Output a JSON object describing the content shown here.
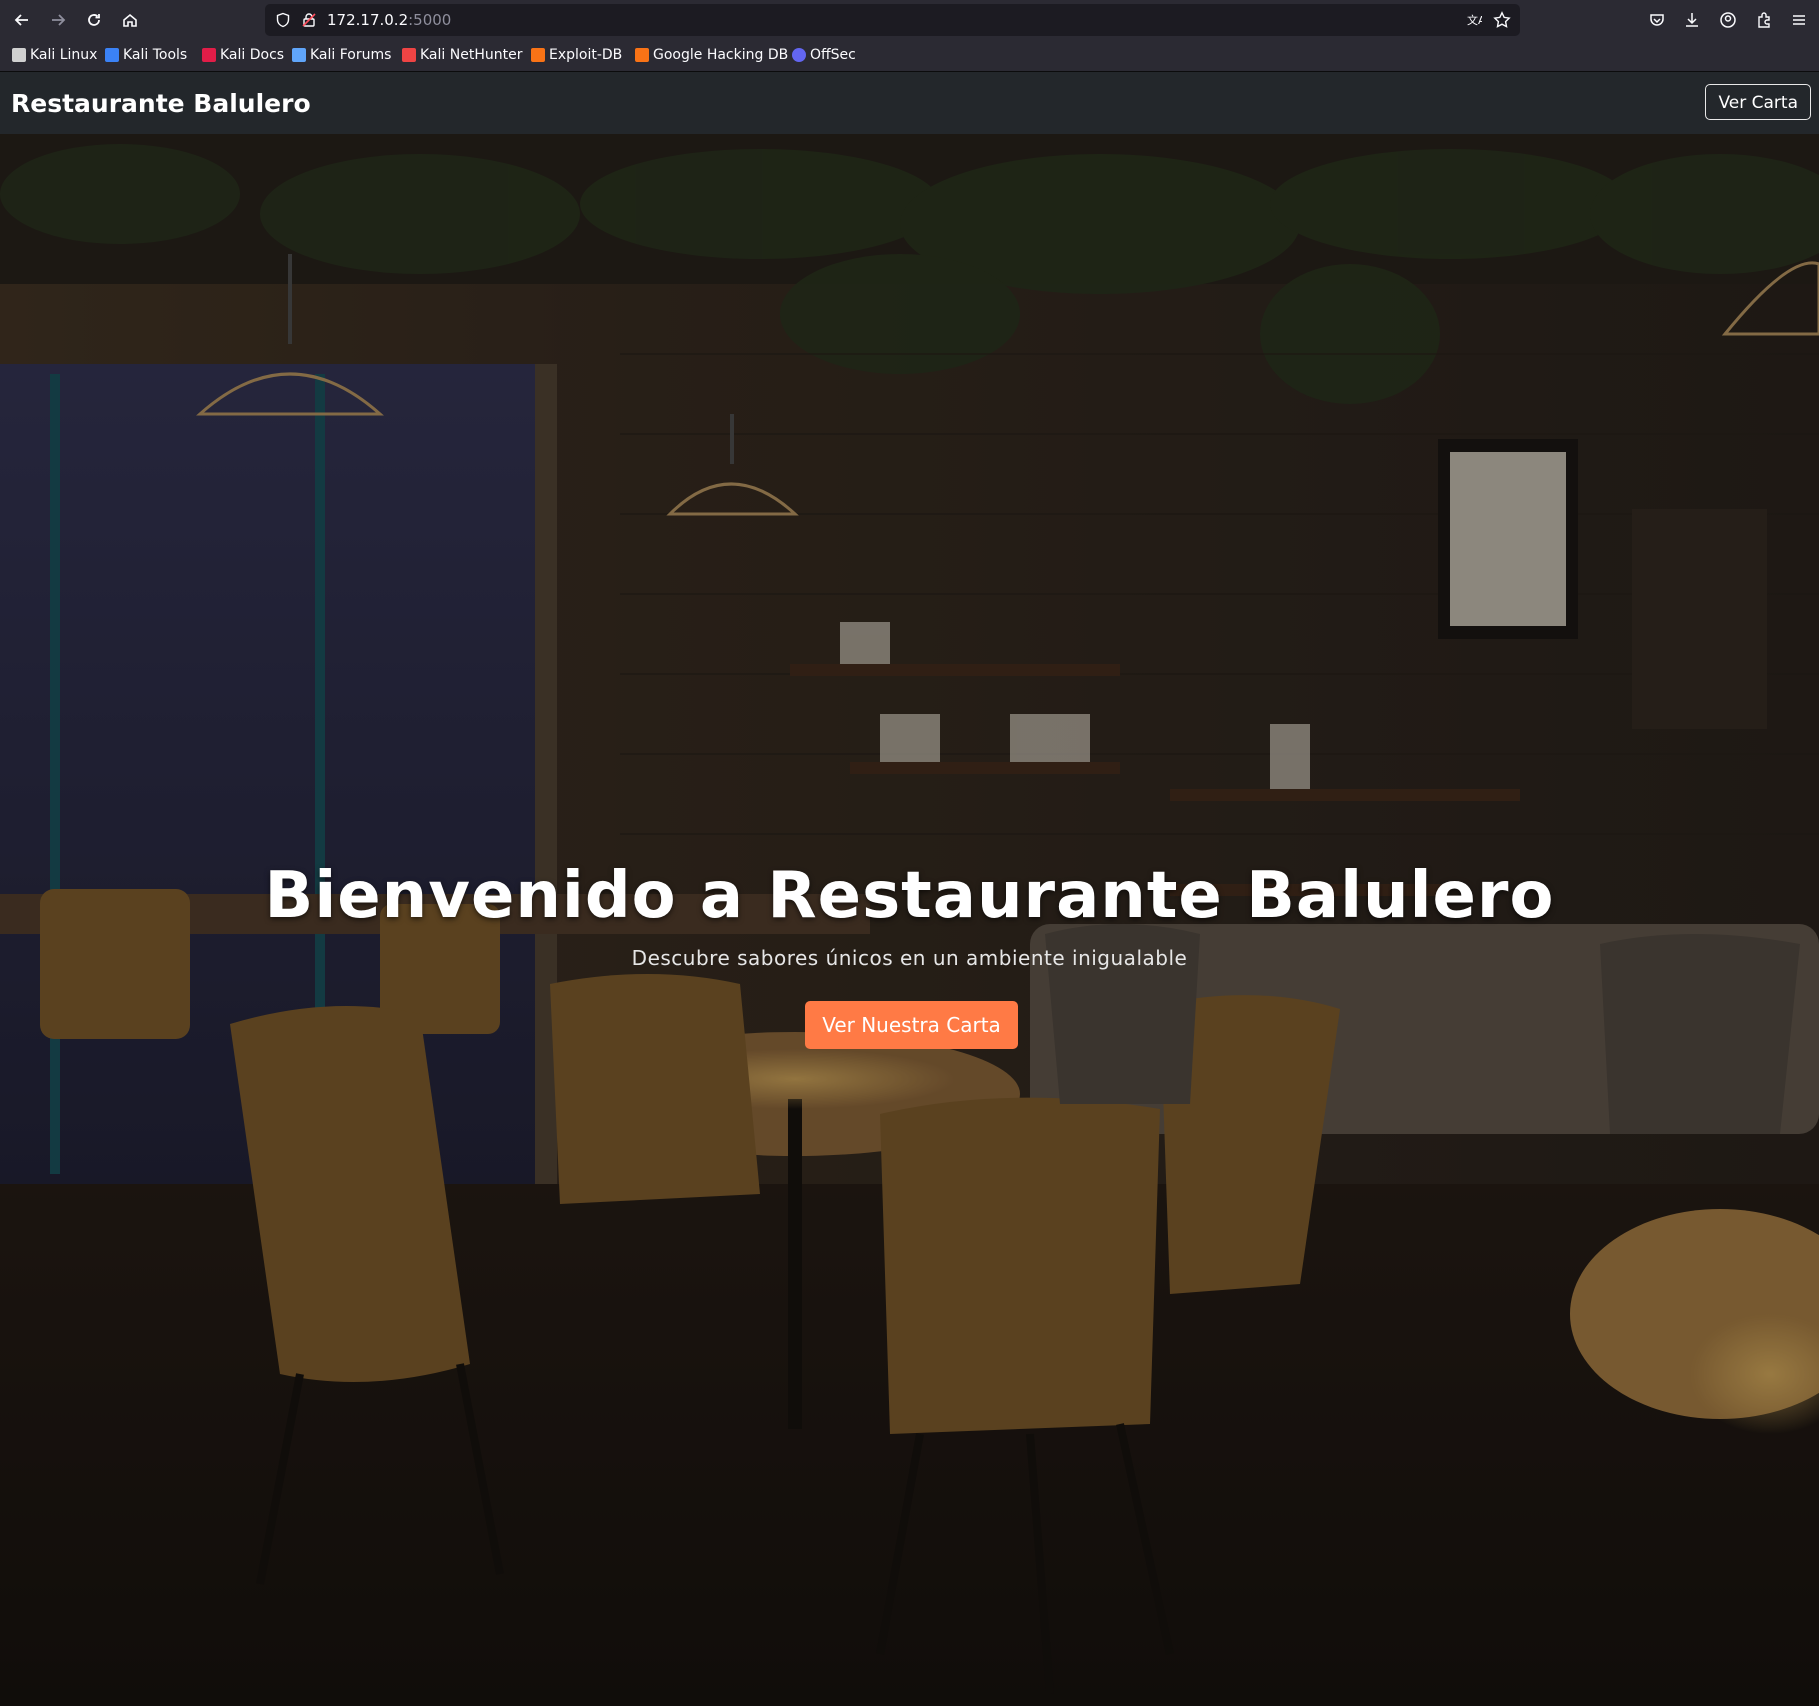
{
  "browser": {
    "url_host": "172.17.0.2",
    "url_port": ":5000",
    "bookmarks": [
      {
        "label": "Kali Linux",
        "color": "#d0d0d0"
      },
      {
        "label": "Kali Tools",
        "color": "#3b82f6"
      },
      {
        "label": "Kali Docs",
        "color": "#e11d48"
      },
      {
        "label": "Kali Forums",
        "color": "#60a5fa"
      },
      {
        "label": "Kali NetHunter",
        "color": "#ef4444"
      },
      {
        "label": "Exploit-DB",
        "color": "#f97316"
      },
      {
        "label": "Google Hacking DB",
        "color": "#f97316"
      },
      {
        "label": "OffSec",
        "color": "#6366f1"
      }
    ]
  },
  "navbar": {
    "brand": "Restaurante Balulero",
    "cta_label": "Ver Carta"
  },
  "hero": {
    "title": "Bienvenido a Restaurante Balulero",
    "subtitle": "Descubre sabores únicos en un ambiente inigualable",
    "cta_label": "Ver Nuestra Carta",
    "accent_color": "#ff7a45"
  }
}
